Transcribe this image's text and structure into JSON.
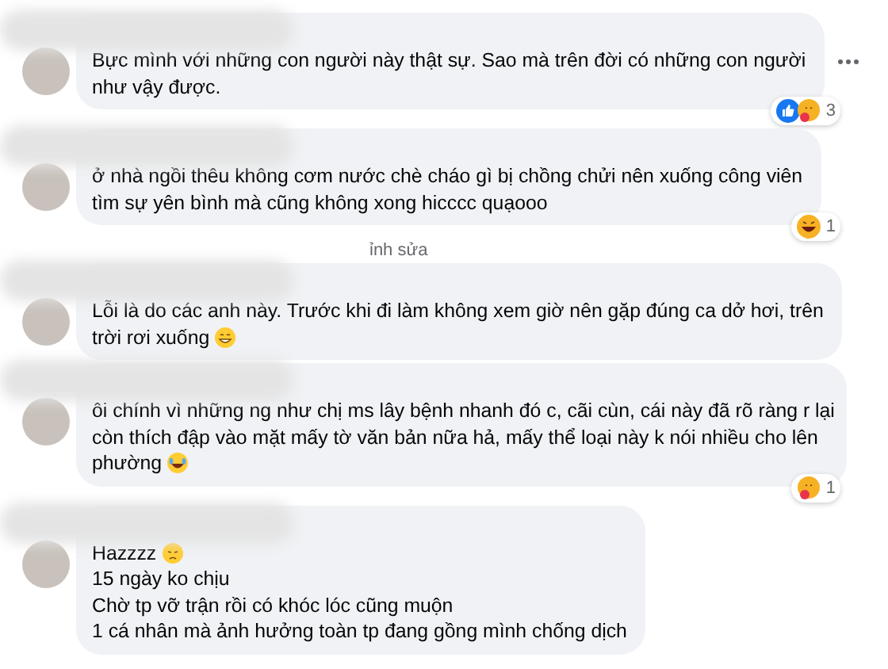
{
  "comments": [
    {
      "lines": [
        {
          "text": "Bực mình với những con người này thật sự. Sao mà trên đời có những con người"
        },
        {
          "text": "như vậy được."
        }
      ],
      "more_menu": true,
      "reactions": {
        "icons": [
          {
            "kind": "like"
          },
          {
            "kind": "care"
          }
        ],
        "count": "3"
      }
    },
    {
      "lines": [
        {
          "text": "ở nhà ngồi thêu không cơm nước chè cháo gì bị chồng chửi nên xuống công viên"
        },
        {
          "text": "tìm sự yên bình mà cũng không xong hicccc quạooo"
        }
      ],
      "more_menu": false,
      "reactions": {
        "icons": [
          {
            "kind": "haha"
          }
        ],
        "count": "1"
      },
      "meta": "ỉnh sửa"
    },
    {
      "lines": [
        {
          "text": "Lỗi là do các anh này. Trước khi đi làm không xem giờ nên gặp đúng ca dở hơi, trên"
        },
        {
          "text": "trời rơi xuống",
          "emoji": {
            "kind": "grin"
          }
        }
      ],
      "more_menu": false
    },
    {
      "lines": [
        {
          "text": "ôi chính vì những ng như chị ms lây bệnh nhanh đó c, cãi cùn, cái này đã rõ ràng r lại"
        },
        {
          "text": "còn thích đập vào mặt mấy tờ văn bản nữa hả, mấy thể loại này k nói nhiều cho lên"
        },
        {
          "text": "phường",
          "emoji": {
            "kind": "laugh"
          }
        }
      ],
      "more_menu": false,
      "reactions": {
        "icons": [
          {
            "kind": "care"
          }
        ],
        "count": "1"
      }
    },
    {
      "lines": [
        {
          "text": "Hazzzz",
          "emoji": {
            "kind": "sad"
          }
        },
        {
          "text": "15 ngày ko chịu"
        },
        {
          "text": "Chờ tp vỡ trận rồi có khóc lóc cũng muộn"
        },
        {
          "text": "1 cá nhân mà ảnh hưởng toàn tp đang gồng mình chống dịch"
        }
      ],
      "more_menu": false
    }
  ]
}
